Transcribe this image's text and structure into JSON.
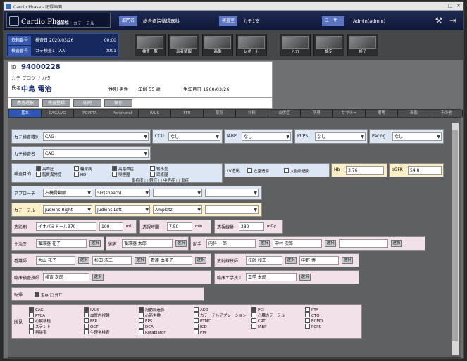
{
  "window": {
    "title": "Cardio Phase ‑ 記録画面",
    "minimize": "—",
    "maximize": "□",
    "close": "✕"
  },
  "header": {
    "logo": "Cardio Phase",
    "logo_sub": "循環器・カテーテル",
    "dept_label": "部門名",
    "dept_value": "総合病院循環器科",
    "room_label": "検査室",
    "room_value": "カテ1室",
    "user_label": "ユーザー",
    "user_value": "Admin(admin)"
  },
  "toolbar": {
    "row1_label": "依頼番号",
    "row1_value": "検査日  2020/03/26",
    "row1_extra": "00:00",
    "row2_label": "検査番号",
    "row2_value": "カテ検査1（AA）",
    "row2_extra": "0001",
    "buttons": [
      "検査一覧",
      "患者情報",
      "画像",
      "レポート",
      "入力",
      "設定",
      "終了"
    ]
  },
  "patient": {
    "id_label": "ID",
    "id": "94000228",
    "kana": "カテ プログ ナカタ",
    "name_label": "氏名",
    "name": "中島 電治",
    "gender": "性別 男性",
    "age": "年齢 55 歳",
    "dob": "生年月日 1960/03/26"
  },
  "actions": [
    "患者選択",
    "検査登録",
    "印刷",
    "保存"
  ],
  "tabs": [
    "基本",
    "CAG/LVG",
    "PCI/PTA",
    "Peripheral",
    "IVUS",
    "FFR",
    "薬剤",
    "材料",
    "合併症",
    "所見",
    "サマリー",
    "備考",
    "画像",
    "その他"
  ],
  "form": {
    "row1": {
      "label1": "カテ検査種別",
      "v1": "CAG",
      "label2": "CCU",
      "v2": "なし",
      "label3": "IABP",
      "v3": "なし",
      "label4": "PCPS",
      "v4": "なし",
      "label5": "Pacing",
      "v5": "なし"
    },
    "row2": {
      "label": "カテ検査名",
      "v": "CAG"
    },
    "row3": {
      "label": "検査目的",
      "opts": [
        "高血圧",
        "糖尿病",
        "高脂血症",
        "腎不全",
        "脂質異常症",
        "HD",
        "喫煙歴",
        "家族歴"
      ],
      "tail": "重症度 □ 軽症 □ 中等症 □ 重症",
      "lv_label": "LV造影",
      "lv_opts": [
        "左室造影",
        "大動脈造影"
      ],
      "hb_label": "Hb",
      "hb": "3.76",
      "egfr_label": "eGFR",
      "egfr": "54.8"
    },
    "row4": {
      "label": "アプローチ",
      "v1": "右橈骨動脈",
      "v2": "5Fr(sheath)"
    },
    "row5": {
      "label": "カテーテル",
      "v1": "Judkins Right",
      "v2": "Judkins Left",
      "v3": "Amplatz"
    },
    "row6": {
      "label1": "造影剤",
      "v1": "イオパミドール370",
      "v1b": "100",
      "unit1": "mL",
      "label2": "透視時間",
      "v2": "7.50",
      "unit2": "min",
      "label3": "透視線量",
      "v3": "280",
      "unit3": "mGy"
    },
    "row7": {
      "label1": "主治医",
      "v1": "循環器 花子",
      "btn": "選択",
      "label2": "術者",
      "v2": "循環器 太郎",
      "label3": "助手",
      "v3": "内科 一郎",
      "v3b": "中村 次郎"
    },
    "row8": {
      "label1": "看護師",
      "v1": "大山 花子",
      "v1b": "杉田 浩二",
      "v1c": "看護 由美子",
      "label2": "放射線技師",
      "v2": "技師 和正",
      "v2b": "中野 博"
    },
    "row9": {
      "label1": "臨床検査技師",
      "v1": "検査 次郎",
      "label2": "臨床工学技士",
      "v2": "工学 太郎"
    },
    "row10": {
      "label": "転帰",
      "v": "生存  □  死亡"
    },
    "row11": {
      "label": "所見",
      "cols": [
        [
          "CAG",
          "PTCA",
          "心臓移植",
          "ステント",
          "再狭窄"
        ],
        [
          "IVUS",
          "血管内視鏡",
          "FFR",
          "OCT",
          "生理学検査"
        ],
        [
          "冠動脈造影",
          "心筋生検",
          "EPS",
          "DCA",
          "Rotablator"
        ],
        [
          "ASO",
          "カテーテルアブレーション",
          "PTMC",
          "ICD",
          "PMI"
        ],
        [
          "PCI",
          "心臓カテーテル",
          "CRT",
          "IABP"
        ],
        [
          "PTA",
          "CTO",
          "ECMO",
          "PCPS"
        ]
      ]
    }
  }
}
